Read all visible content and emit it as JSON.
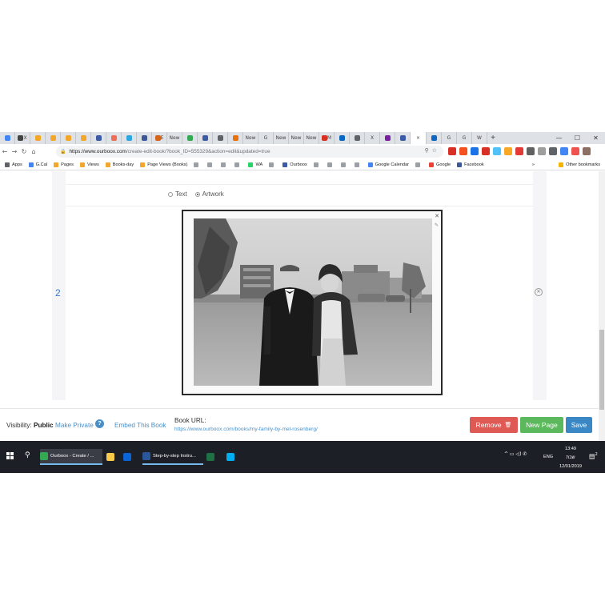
{
  "browser": {
    "tabs": [
      {
        "label": "",
        "color": "#4285f4"
      },
      {
        "label": "X",
        "color": "#444444"
      },
      {
        "label": "",
        "color": "#f4a62a"
      },
      {
        "label": "",
        "color": "#f4a62a"
      },
      {
        "label": "",
        "color": "#f4a62a"
      },
      {
        "label": "",
        "color": "#f4a62a"
      },
      {
        "label": "",
        "color": "#3b5ba5"
      },
      {
        "label": "",
        "color": "#ef6c57"
      },
      {
        "label": "",
        "color": "#2ca5e0"
      },
      {
        "label": "",
        "color": "#3b5998"
      },
      {
        "label": "E",
        "color": "#d5641c"
      },
      {
        "label": "New",
        "color": ""
      },
      {
        "label": "",
        "color": "#34a853"
      },
      {
        "label": "",
        "color": "#3b5ba5"
      },
      {
        "label": "",
        "color": "#5f6368"
      },
      {
        "label": "",
        "color": "#e8710a"
      },
      {
        "label": "New",
        "color": ""
      },
      {
        "label": "G",
        "color": ""
      },
      {
        "label": "New",
        "color": ""
      },
      {
        "label": "New",
        "color": ""
      },
      {
        "label": "New",
        "color": ""
      },
      {
        "label": "M",
        "color": "#d93025"
      },
      {
        "label": "",
        "color": "#0a66c2"
      },
      {
        "label": "",
        "color": "#5f6368"
      },
      {
        "label": "X",
        "color": ""
      },
      {
        "label": "",
        "color": "#7b1fa2"
      },
      {
        "label": "",
        "color": "#3b5ba5"
      },
      {
        "label": "×",
        "color": "",
        "active": true
      },
      {
        "label": "",
        "color": "#0a66c2"
      },
      {
        "label": "G",
        "color": ""
      },
      {
        "label": "G",
        "color": ""
      },
      {
        "label": "W",
        "color": ""
      }
    ],
    "new_tab": "+",
    "window_controls": [
      "—",
      "☐",
      "✕"
    ],
    "url": {
      "domain": "https://www.ourboox.com",
      "path": "/create-edit-book/?book_ID=555329&action=edit&updated=true"
    },
    "extension_colors": [
      "#d93025",
      "#f4511e",
      "#1a73e8",
      "#d93025",
      "#4fc3f7",
      "#f9a825",
      "#e53935",
      "#616161",
      "#9e9e9e",
      "#5f6368",
      "#4285f4",
      "#ef5350",
      "#8d6e63"
    ],
    "bookmarks": [
      {
        "label": "Apps",
        "color": "#5f6368"
      },
      {
        "label": "G.Cal",
        "color": "#4285f4"
      },
      {
        "label": "Pages",
        "color": "#f4a62a"
      },
      {
        "label": "Views",
        "color": "#f4a62a"
      },
      {
        "label": "Books-day",
        "color": "#f4a62a"
      },
      {
        "label": "Page Views (Books)",
        "color": "#f4a62a"
      },
      {
        "label": "",
        "color": "#9aa0a6"
      },
      {
        "label": "",
        "color": "#9aa0a6"
      },
      {
        "label": "",
        "color": "#9aa0a6"
      },
      {
        "label": "",
        "color": "#9aa0a6"
      },
      {
        "label": "WA",
        "color": "#25d366"
      },
      {
        "label": "",
        "color": "#9aa0a6"
      },
      {
        "label": "Ourboox",
        "color": "#3b5ba5"
      },
      {
        "label": "",
        "color": "#9aa0a6"
      },
      {
        "label": "",
        "color": "#9aa0a6"
      },
      {
        "label": "",
        "color": "#9aa0a6"
      },
      {
        "label": "",
        "color": "#9aa0a6"
      },
      {
        "label": "Google Calendar",
        "color": "#4285f4"
      },
      {
        "label": "",
        "color": "#9aa0a6"
      },
      {
        "label": "Google",
        "color": "#ea4335"
      },
      {
        "label": "Facebook",
        "color": "#3b5998"
      }
    ],
    "bookmarks_more": "»",
    "other_bookmarks": "Other bookmarks"
  },
  "editor": {
    "type_options": [
      {
        "label": "Text",
        "selected": false
      },
      {
        "label": "Artwork",
        "selected": true
      }
    ],
    "page_number": "2",
    "photo_close": "✕",
    "photo_edit": "✎",
    "delete_page": "✕"
  },
  "footer": {
    "visibility_label": "Visibility:",
    "visibility_value": "Public",
    "make_private": "Make Private",
    "help": "?",
    "embed": "Embed This Book",
    "book_url_label": "Book URL:",
    "book_url": "https://www.ourboox.com/books/my-family-by-mel-rosenberg/",
    "remove": "Remove",
    "remove_icon": "🗑",
    "new_page": "New Page",
    "save": "Save",
    "colors": {
      "remove": "#e05a55",
      "new_page": "#5cb85c",
      "save": "#3a87c6"
    }
  },
  "taskbar": {
    "apps": [
      {
        "label": "Ourboox - Create / ...",
        "color": "#34a853",
        "state": "active"
      },
      {
        "label": "",
        "color": "#f9c94a",
        "state": ""
      },
      {
        "label": "",
        "color": "#0a64d6",
        "state": ""
      },
      {
        "label": "Step-by-step Instru...",
        "color": "#2b579a",
        "state": "running"
      },
      {
        "label": "",
        "color": "#1e7145",
        "state": ""
      },
      {
        "label": "",
        "color": "#00aff0",
        "state": ""
      }
    ],
    "tray": "^  ▭  ◁)  ✆",
    "lang": "ENG",
    "time": "13:49",
    "day": "שבת",
    "date": "12/01/2019",
    "notifications": "2"
  }
}
